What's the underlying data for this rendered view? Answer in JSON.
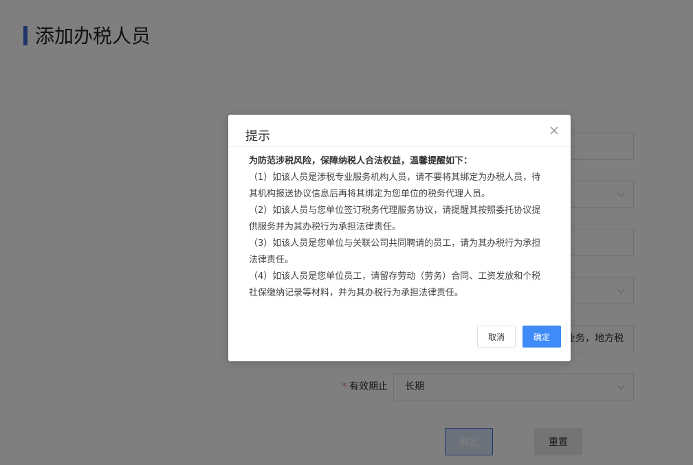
{
  "page": {
    "title": "添加办税人员",
    "accent_color": "#3f6ad8"
  },
  "form": {
    "row5_value": "业务，地方税",
    "validity_label": "有效期止",
    "validity_value": "长期",
    "submit_label": "确定",
    "reset_label": "重置"
  },
  "dialog": {
    "title": "提示",
    "lead": "为防范涉税风险，保障纳税人合法权益，温馨提醒如下：",
    "items": [
      "（1）如该人员是涉税专业服务机构人员，请不要将其绑定为办税人员，待其机构报送协议信息后再将其绑定为您单位的税务代理人员。",
      "（2）如该人员与您单位签订税务代理服务协议，请提醒其按照委托协议提供服务并为其办税行为承担法律责任。",
      "（3）如该人员是您单位与关联公司共同聘请的员工，请为其办税行为承担法律责任。",
      "（4）如该人员是您单位员工，请留存劳动（劳务）合同、工资发放和个税社保缴纳记录等材料，并为其办税行为承担法律责任。"
    ],
    "cancel_label": "取消",
    "confirm_label": "确定",
    "close_icon": "close-icon",
    "confirm_color": "#3f8bf7"
  }
}
